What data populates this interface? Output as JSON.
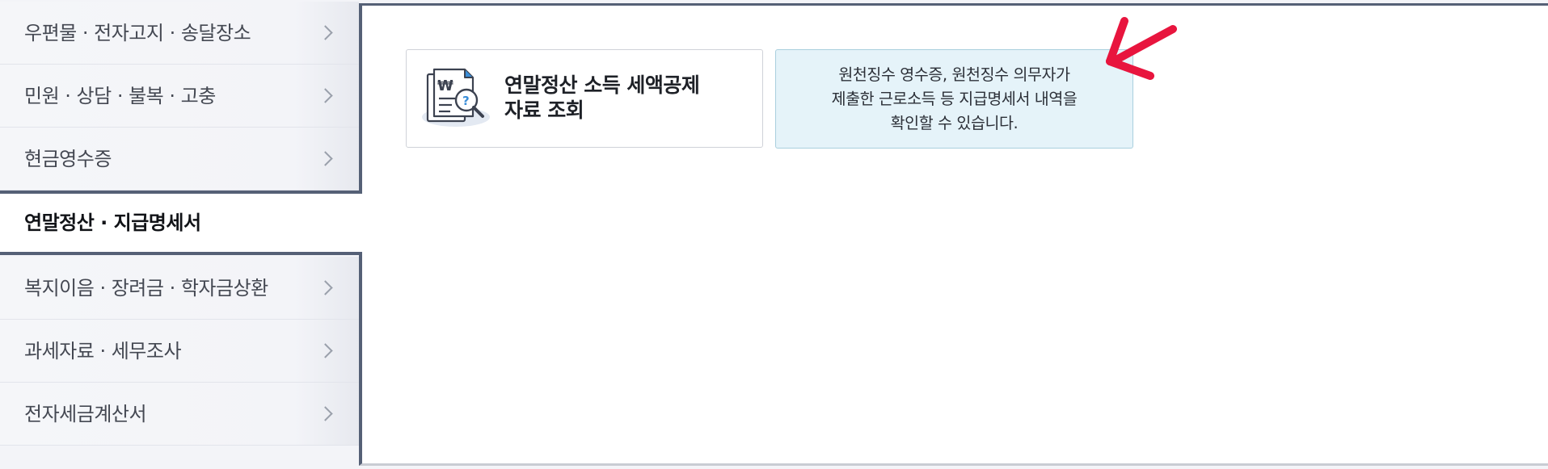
{
  "sidebar": {
    "items": [
      {
        "label": "우편물 · 전자고지 · 송달장소",
        "active": false
      },
      {
        "label": "민원 · 상담 · 불복 · 고충",
        "active": false
      },
      {
        "label": "현금영수증",
        "active": false
      },
      {
        "label": "연말정산 · 지급명세서",
        "active": true
      },
      {
        "label": "복지이음 · 장려금 · 학자금상환",
        "active": false
      },
      {
        "label": "과세자료 · 세무조사",
        "active": false
      },
      {
        "label": "전자세금계산서",
        "active": false
      }
    ]
  },
  "main": {
    "card": {
      "title_line1": "연말정산 소득 세액공제",
      "title_line2": "자료 조회",
      "icon": "document-search-icon"
    },
    "tooltip": {
      "line1": "원천징수 영수증, 원천징수 의무자가",
      "line2": "제출한 근로소득 등 지급명세서 내역을",
      "line3": "확인할 수 있습니다."
    },
    "annotation": {
      "icon": "pointer-arrow-icon",
      "color": "#e8153e"
    }
  },
  "colors": {
    "accent_border": "#556076",
    "sidebar_bg": "#f3f4f8",
    "tooltip_bg": "#e5f3f9",
    "tooltip_border": "#a9cfde",
    "icon_blue": "#3a8ed8"
  }
}
